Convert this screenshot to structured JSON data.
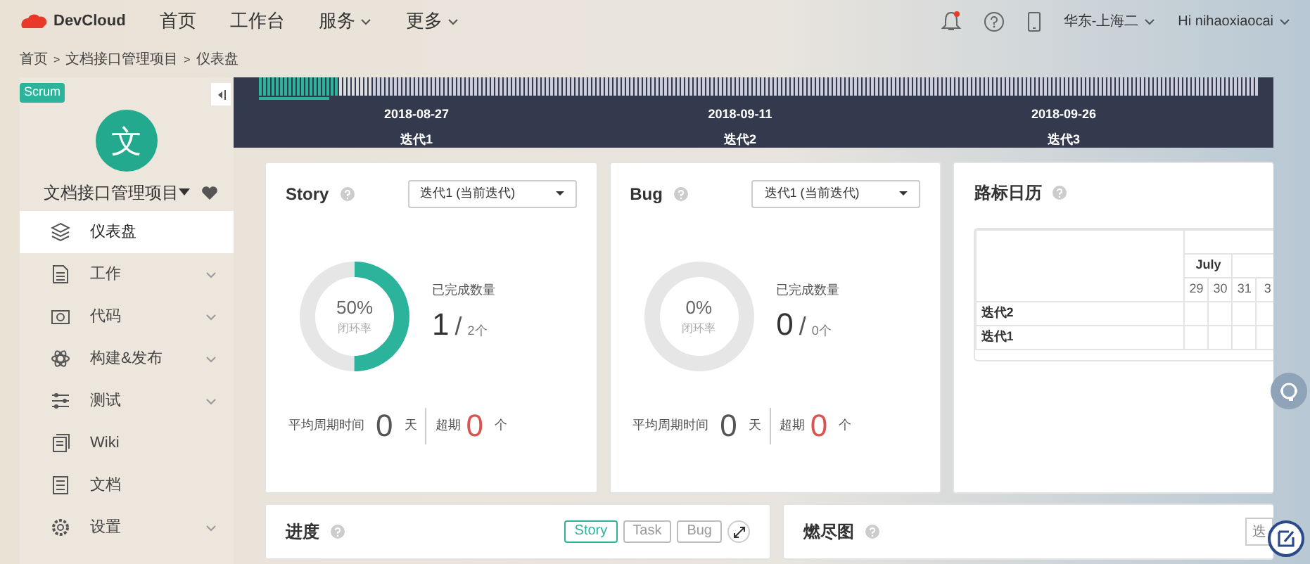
{
  "topbar": {
    "brand": "DevCloud",
    "links": [
      {
        "label": "首页",
        "dropdown": false
      },
      {
        "label": "工作台",
        "dropdown": false
      },
      {
        "label": "服务",
        "dropdown": true
      },
      {
        "label": "更多",
        "dropdown": true
      }
    ],
    "notification": true,
    "region": "华东-上海二",
    "user": "Hi nihaoxiaocai"
  },
  "breadcrumb": {
    "separator": ">",
    "items": [
      "首页",
      "文档接口管理项目",
      "仪表盘"
    ]
  },
  "sidebar": {
    "badge": "Scrum",
    "avatar": "文",
    "project": "文档接口管理项目",
    "items": [
      {
        "label": "仪表盘",
        "selected": true,
        "expandable": false
      },
      {
        "label": "工作",
        "selected": false,
        "expandable": true
      },
      {
        "label": "代码",
        "selected": false,
        "expandable": true
      },
      {
        "label": "构建&发布",
        "selected": false,
        "expandable": true
      },
      {
        "label": "测试",
        "selected": false,
        "expandable": true
      },
      {
        "label": "Wiki",
        "selected": false,
        "expandable": false
      },
      {
        "label": "文档",
        "selected": false,
        "expandable": false
      },
      {
        "label": "设置",
        "selected": false,
        "expandable": true
      }
    ]
  },
  "timeline": {
    "milestones": [
      {
        "date": "2018-08-27",
        "label": "迭代1"
      },
      {
        "date": "2018-09-11",
        "label": "迭代2"
      },
      {
        "date": "2018-09-26",
        "label": "迭代3"
      }
    ]
  },
  "stat_cards": [
    {
      "title": "Story",
      "select": "迭代1 (当前迭代)",
      "percent": "50%",
      "rate_label": "闭环率",
      "level": 0.5,
      "done_label": "已完成数量",
      "done": "1",
      "divider": "/",
      "total": "2个",
      "avg_label": "平均周期时间",
      "avg": "0",
      "avg_unit": "天",
      "overdue_label": "超期",
      "overdue": "0",
      "overdue_unit": "个"
    },
    {
      "title": "Bug",
      "select": "迭代1 (当前迭代)",
      "percent": "0%",
      "rate_label": "闭环率",
      "level": 0,
      "done_label": "已完成数量",
      "done": "0",
      "divider": "/",
      "total": "0个",
      "avg_label": "平均周期时间",
      "avg": "0",
      "avg_unit": "天",
      "overdue_label": "超期",
      "overdue": "0",
      "overdue_unit": "个"
    }
  ],
  "calendar": {
    "title": "路标日历",
    "month": "July",
    "days": [
      "29",
      "30",
      "31",
      "3"
    ],
    "rows": [
      "迭代2",
      "迭代1"
    ]
  },
  "progress": {
    "title": "进度",
    "toggles": [
      {
        "label": "Story",
        "selected": true
      },
      {
        "label": "Task",
        "selected": false
      },
      {
        "label": "Bug",
        "selected": false
      }
    ]
  },
  "burndown": {
    "title": "燃尽图",
    "button": "迭"
  }
}
